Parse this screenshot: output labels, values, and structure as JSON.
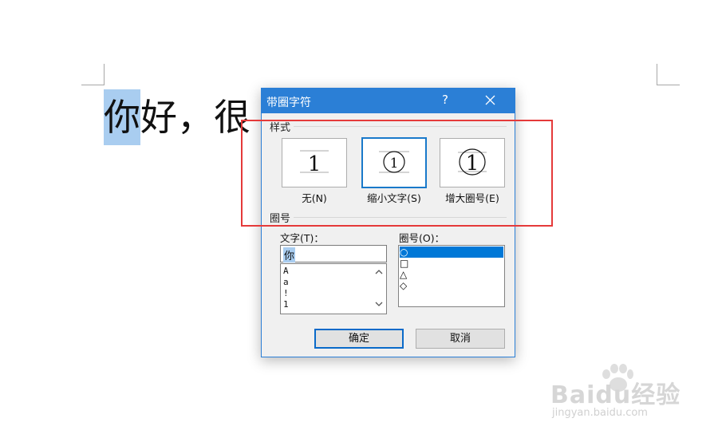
{
  "document": {
    "selected_char": "你",
    "rest_text": "好，很"
  },
  "dialog": {
    "title": "带圈字符",
    "help": "?",
    "style_section": "样式",
    "styles": [
      {
        "label": "无(N)",
        "preview": "1"
      },
      {
        "label": "缩小文字(S)",
        "preview": "①"
      },
      {
        "label": "增大圈号(E)",
        "preview": "①"
      }
    ],
    "circle_section": "圈号",
    "text_label": "文字(T)：",
    "text_value": "你",
    "text_list": [
      "A",
      "a",
      "!",
      "1"
    ],
    "enclosure_label": "圈号(O)：",
    "enclosure_list": [
      "○",
      "□",
      "△",
      "◇"
    ],
    "ok": "确定",
    "cancel": "取消"
  },
  "watermark": {
    "brand": "Baidu经验",
    "url": "jingyan.baidu.com"
  },
  "colors": {
    "titlebar": "#2b7fd6",
    "selection": "#a9cdf0",
    "highlight": "#e53a3a"
  }
}
